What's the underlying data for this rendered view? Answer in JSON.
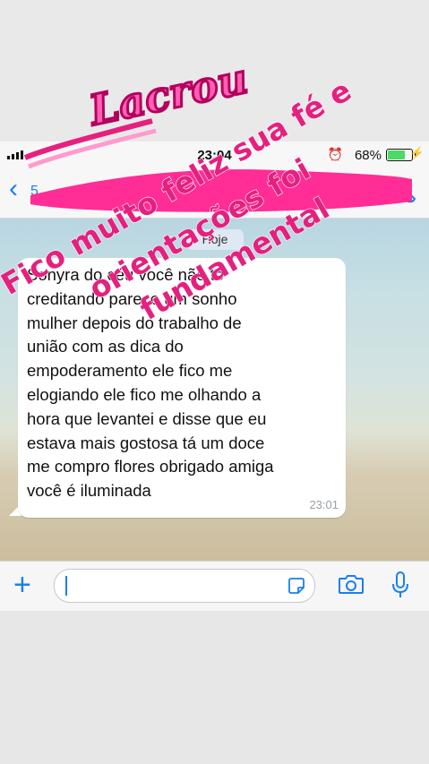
{
  "status_bar": {
    "time": "23:04",
    "battery_pct": "68%",
    "battery_level": 0.68
  },
  "chat": {
    "date_chip": "Hoje",
    "message": {
      "text": "Sonyra do céu você não tô\ncreditando parece um sonho\nmulher  depois do trabalho de\nunião com as dica do\nempoderamento ele fico me\nelogiando ele fico me olhando a\nhora que levantei e disse que eu\nestava mais gostosa  tá um doce\nme compro flores obrigado amiga\nvocê é iluminada",
      "time": "23:01"
    }
  },
  "story": {
    "sticker_text": "Lacrou",
    "caption_lines": [
      "Fico muito feliz sua fé e",
      "orientações foi",
      "fundamental"
    ]
  },
  "colors": {
    "accent": "#1a7ff2",
    "caption": "#e5207f",
    "battery": "#4cd964",
    "scribble": "#ff2d95"
  }
}
